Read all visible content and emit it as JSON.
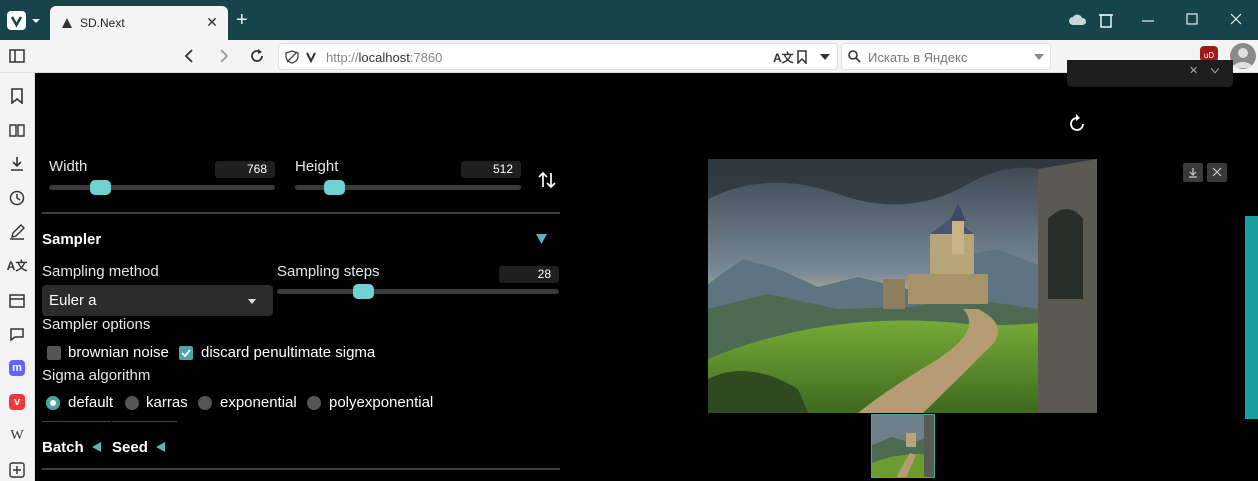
{
  "browser": {
    "tab_title": "SD.Next",
    "url_prefix": "http://",
    "url_host": "localhost",
    "url_port": ":7860",
    "search_placeholder": "Искать в Яндекс",
    "new_tab": "+",
    "tab_close": "✕",
    "profile_initial": "uD"
  },
  "dimensions": {
    "width_label": "Width",
    "width_value": "768",
    "width_fraction": 0.2,
    "height_label": "Height",
    "height_value": "512",
    "height_fraction": 0.14
  },
  "sampler": {
    "title": "Sampler",
    "method_label": "Sampling method",
    "method_value": "Euler a",
    "steps_label": "Sampling steps",
    "steps_value": "28",
    "steps_fraction": 0.29,
    "options_label": "Sampler options",
    "checkboxes": [
      {
        "label": "brownian noise",
        "checked": false
      },
      {
        "label": "discard penultimate sigma",
        "checked": true
      }
    ],
    "sigma_label": "Sigma algorithm",
    "radios": [
      {
        "label": "default",
        "selected": true
      },
      {
        "label": "karras",
        "selected": false
      },
      {
        "label": "exponential",
        "selected": false
      },
      {
        "label": "polyexponential",
        "selected": false
      }
    ]
  },
  "accordions": {
    "batch": "Batch",
    "seed": "Seed"
  },
  "colors": {
    "accent": "#6fd1d1",
    "tabstrip": "#17434a",
    "scroll": "#1a9fa0"
  }
}
